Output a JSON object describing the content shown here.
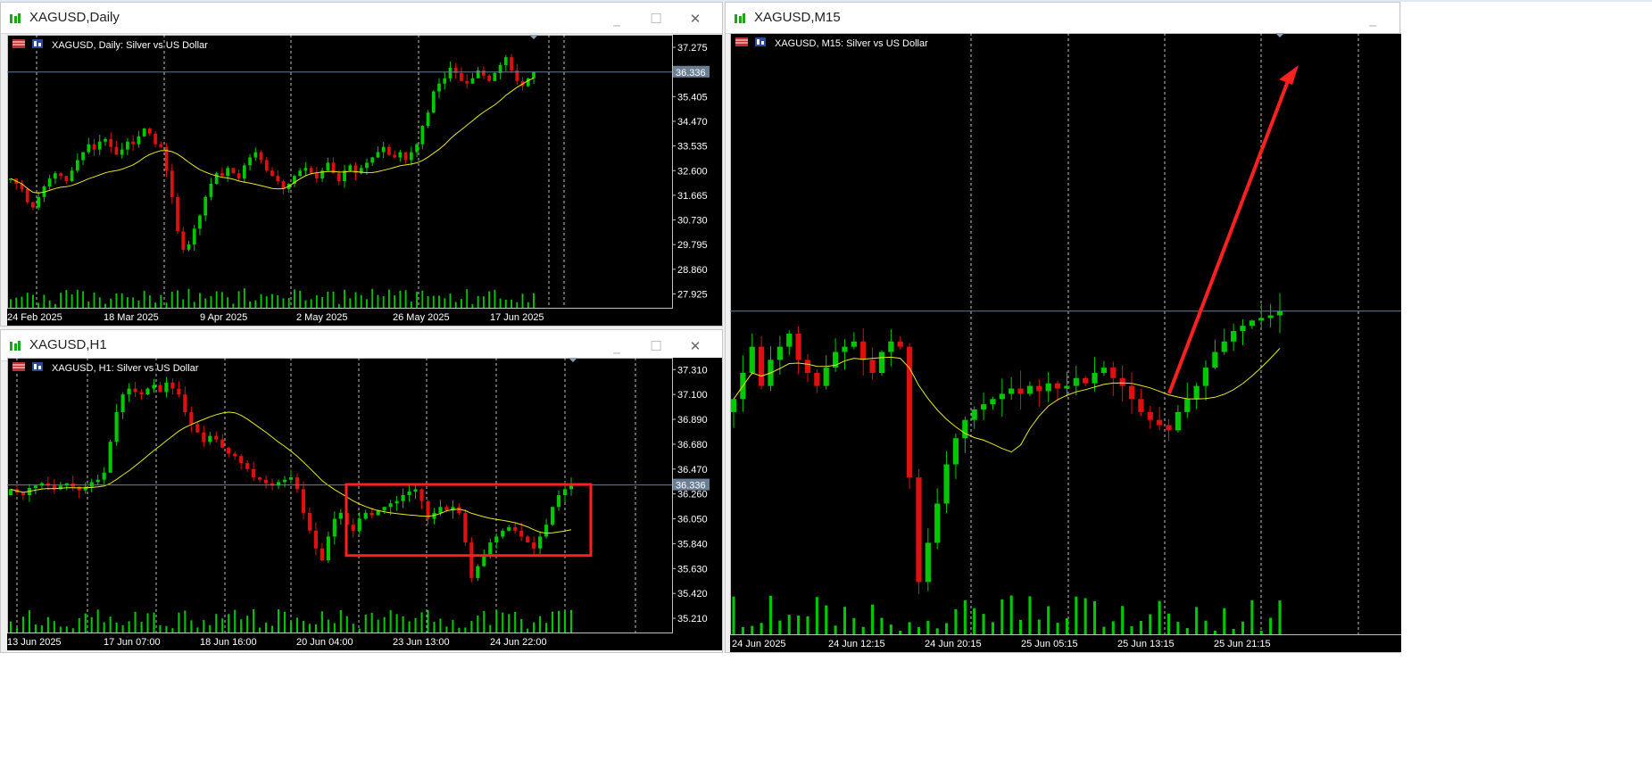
{
  "windows": {
    "daily": {
      "title": "XAGUSD,Daily",
      "header": "XAGUSD, Daily:  Silver vs US Dollar",
      "price_tag": "36.336",
      "y_ticks": [
        "37.275",
        "36.336",
        "35.405",
        "34.470",
        "33.535",
        "32.600",
        "31.665",
        "30.730",
        "29.795",
        "28.860",
        "27.925"
      ],
      "x_ticks": [
        "24 Feb 2025",
        "18 Mar 2025",
        "9 Apr 2025",
        "2 May 2025",
        "26 May 2025",
        "17 Jun 2025"
      ]
    },
    "h1": {
      "title": "XAGUSD,H1",
      "header": "XAGUSD, H1:  Silver vs US Dollar",
      "price_tag": "36.336",
      "y_ticks": [
        "37.310",
        "37.100",
        "36.890",
        "36.680",
        "36.470",
        "36.336",
        "36.260",
        "36.050",
        "35.840",
        "35.630",
        "35.420",
        "35.210"
      ],
      "x_ticks": [
        "13 Jun 2025",
        "17 Jun 07:00",
        "18 Jun 16:00",
        "20 Jun 04:00",
        "23 Jun 13:00",
        "24 Jun 22:00"
      ]
    },
    "m15": {
      "title": "XAGUSD,M15",
      "header": "XAGUSD, M15:  Silver vs US Dollar",
      "x_ticks": [
        "24 Jun 2025",
        "24 Jun 12:15",
        "24 Jun 20:15",
        "25 Jun 05:15",
        "25 Jun 13:15",
        "25 Jun 21:15"
      ]
    }
  },
  "buttons": {
    "minimize": "_",
    "maximize": "☐",
    "close": "✕"
  },
  "colors": {
    "bull": "#00c800",
    "bear": "#e01010",
    "ma": "#e8e820",
    "annotation": "#ff2020",
    "grid": "#ffffff",
    "price_line": "#6b7f94"
  },
  "chart_data": [
    {
      "type": "candlestick",
      "title": "XAGUSD, Daily:  Silver vs US Dollar",
      "symbol": "XAGUSD",
      "timeframe": "Daily",
      "ylim": [
        27.4,
        37.75
      ],
      "last_price": 36.336,
      "close": [
        32.3,
        32.1,
        31.9,
        31.4,
        31.2,
        31.6,
        32.0,
        32.3,
        32.5,
        32.4,
        32.2,
        32.6,
        33.0,
        33.3,
        33.6,
        33.4,
        33.7,
        33.8,
        33.5,
        33.2,
        33.4,
        33.7,
        33.6,
        33.9,
        34.2,
        34.0,
        33.6,
        33.5,
        32.6,
        31.6,
        30.3,
        29.6,
        29.8,
        30.4,
        30.9,
        31.6,
        32.1,
        32.5,
        32.4,
        32.7,
        32.5,
        32.3,
        32.8,
        33.1,
        33.3,
        33.0,
        32.6,
        32.4,
        32.2,
        31.9,
        32.1,
        32.4,
        32.6,
        32.7,
        32.5,
        32.3,
        32.6,
        32.9,
        32.5,
        32.2,
        32.6,
        32.8,
        32.5,
        32.7,
        32.9,
        33.1,
        33.3,
        33.5,
        33.2,
        33.1,
        33.3,
        33.0,
        33.3,
        33.6,
        34.3,
        34.8,
        35.6,
        35.9,
        36.1,
        36.5,
        36.3,
        36.0,
        35.9,
        36.1,
        36.4,
        36.2,
        36.0,
        36.3,
        36.6,
        36.9,
        36.4,
        36.0,
        35.8,
        36.1,
        36.336
      ],
      "ma_period_note": "",
      "annotation": "",
      "x_ticks": [
        "24 Feb 2025",
        "18 Mar 2025",
        "9 Apr 2025",
        "2 May 2025",
        "26 May 2025",
        "17 Jun 2025"
      ]
    },
    {
      "type": "candlestick",
      "title": "XAGUSD, H1:  Silver vs US Dollar",
      "symbol": "XAGUSD",
      "timeframe": "H1",
      "ylim": [
        35.09,
        37.41
      ],
      "last_price": 36.336,
      "close": [
        36.3,
        36.27,
        36.25,
        36.31,
        36.33,
        36.35,
        36.33,
        36.3,
        36.33,
        36.35,
        36.32,
        36.29,
        36.32,
        36.36,
        36.38,
        36.44,
        36.7,
        36.95,
        37.1,
        37.15,
        37.12,
        37.1,
        37.15,
        37.18,
        37.12,
        37.2,
        37.15,
        37.1,
        36.95,
        36.85,
        36.78,
        36.7,
        36.75,
        36.72,
        36.65,
        36.6,
        36.58,
        36.52,
        36.47,
        36.4,
        36.38,
        36.35,
        36.33,
        36.36,
        36.38,
        36.4,
        36.3,
        36.1,
        35.95,
        35.8,
        35.7,
        35.9,
        36.05,
        36.1,
        36.0,
        35.95,
        36.05,
        36.1,
        36.08,
        36.12,
        36.15,
        36.18,
        36.2,
        36.25,
        36.28,
        36.3,
        36.2,
        36.05,
        36.1,
        36.15,
        36.12,
        36.15,
        36.1,
        35.85,
        35.55,
        35.65,
        35.75,
        35.85,
        35.9,
        35.95,
        35.98,
        35.95,
        35.9,
        35.85,
        35.8,
        35.9,
        36.0,
        36.15,
        36.25,
        36.3,
        36.336
      ],
      "box_range": [
        35.74,
        36.34
      ],
      "x_ticks": [
        "13 Jun 2025",
        "17 Jun 07:00",
        "18 Jun 16:00",
        "20 Jun 04:00",
        "23 Jun 13:00",
        "24 Jun 22:00"
      ]
    },
    {
      "type": "candlestick",
      "title": "XAGUSD, M15:  Silver vs US Dollar",
      "symbol": "XAGUSD",
      "timeframe": "M15",
      "ylim": [
        35.1,
        37.4
      ],
      "last_price": 36.336,
      "close": [
        36.0,
        36.1,
        36.2,
        36.05,
        36.15,
        36.2,
        36.25,
        36.15,
        36.1,
        36.05,
        36.12,
        36.18,
        36.2,
        36.22,
        36.15,
        36.1,
        36.18,
        36.22,
        36.2,
        35.7,
        35.3,
        35.45,
        35.6,
        35.75,
        35.85,
        35.92,
        35.96,
        35.98,
        36.0,
        36.02,
        36.04,
        36.02,
        36.05,
        36.03,
        36.06,
        36.04,
        36.05,
        36.08,
        36.06,
        36.1,
        36.12,
        36.08,
        36.05,
        36.0,
        35.95,
        35.92,
        35.9,
        35.88,
        35.95,
        36.0,
        36.05,
        36.12,
        36.18,
        36.22,
        36.26,
        36.28,
        36.3,
        36.31,
        36.32,
        36.336
      ],
      "annotation": "arrow",
      "x_ticks": [
        "24 Jun 2025",
        "24 Jun 12:15",
        "24 Jun 20:15",
        "25 Jun 05:15",
        "25 Jun 13:15",
        "25 Jun 21:15"
      ]
    }
  ]
}
